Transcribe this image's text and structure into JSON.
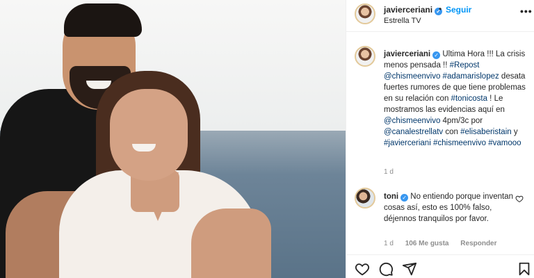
{
  "post": {
    "username": "javierceriani",
    "follow_label": "Seguir",
    "separator": "•",
    "location": "Estrella TV",
    "more_label": "•••"
  },
  "caption": {
    "username": "javierceriani",
    "parts": [
      {
        "t": "Ultima Hora !!! La crisis menos pensada !! ",
        "tag": false
      },
      {
        "t": "#Repost",
        "tag": true
      },
      {
        "t": " ",
        "tag": false
      },
      {
        "t": "@chismeenvivo",
        "tag": true
      },
      {
        "t": " ",
        "tag": false
      },
      {
        "t": "#adamarislopez",
        "tag": true
      },
      {
        "t": " desata fuertes rumores de que tiene problemas en su relación con ",
        "tag": false
      },
      {
        "t": "#tonicosta",
        "tag": true
      },
      {
        "t": " ! Le mostramos las evidencias aquí en ",
        "tag": false
      },
      {
        "t": "@chismeenvivo",
        "tag": true
      },
      {
        "t": " 4pm/3c por ",
        "tag": false
      },
      {
        "t": "@canalestrellatv",
        "tag": true
      },
      {
        "t": " con ",
        "tag": false
      },
      {
        "t": "#elisaberistain",
        "tag": true
      },
      {
        "t": " y ",
        "tag": false
      },
      {
        "t": "#javierceriani",
        "tag": true
      },
      {
        "t": " ",
        "tag": false
      },
      {
        "t": "#chismeenvivo",
        "tag": true
      },
      {
        "t": " ",
        "tag": false
      },
      {
        "t": "#vamooo",
        "tag": true
      }
    ],
    "age": "1 d"
  },
  "comment": {
    "username": "toni",
    "text": "No entiendo porque inventan cosas así, esto es 100% falso, déjennos tranquilos por favor.",
    "age": "1 d",
    "likes": "106 Me gusta",
    "reply_label": "Responder"
  },
  "icons": {
    "verified": "verified-badge-icon",
    "like": "heart-icon",
    "comment": "comment-icon",
    "share": "share-icon",
    "save": "bookmark-icon"
  },
  "colors": {
    "link": "#00376b",
    "follow": "#0095f6",
    "verified": "#3897f0",
    "muted": "#8e8e8e"
  }
}
